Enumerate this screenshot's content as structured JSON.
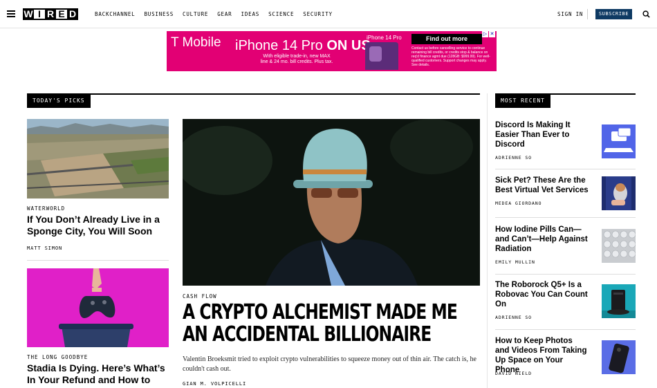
{
  "header": {
    "logo_letters": [
      "W",
      "I",
      "R",
      "E",
      "D"
    ],
    "nav": [
      "BACKCHANNEL",
      "BUSINESS",
      "CULTURE",
      "GEAR",
      "IDEAS",
      "SCIENCE",
      "SECURITY"
    ],
    "sign_in": "SIGN IN",
    "subscribe": "SUBSCRIBE"
  },
  "ad": {
    "brand": "T Mobile",
    "headline_a": "iPhone 14 Pro",
    "headline_b": "ON US",
    "sub": "With eligible trade-in, new MAX line & 24 mo. bill credits. Plus tax.",
    "product_label": "iPhone 14 Pro",
    "cta": "Find out more",
    "fine_print": "Contact us before cancelling service to continue remaining bill credits, or credits stop & balance on req'd finance agmt due (128GB: $999.99). For well-qualified customers. Support changes may apply. See details.",
    "color": "#e20074"
  },
  "picks": {
    "label": "TODAY'S PICKS",
    "left": [
      {
        "kicker": "WATERWORLD",
        "title": "If You Don’t Already Live in a Sponge City, You Will Soon",
        "author": "MATT SIMON"
      },
      {
        "kicker": "THE LONG GOODBYE",
        "title": "Stadia Is Dying. Here’s What’s In Your Refund and How to Get It",
        "author": ""
      }
    ],
    "hero": {
      "kicker": "CASH FLOW",
      "title": "A CRYPTO ALCHEMIST MADE ME AN ACCIDENTAL BILLIONAIRE",
      "dek": "Valentin Broeksmit tried to exploit crypto vulnerabilities to squeeze money out of thin air. The catch is, he couldn't cash out.",
      "author": "GIAN M. VOLPICELLI"
    }
  },
  "most_recent": {
    "label": "MOST RECENT",
    "items": [
      {
        "title": "Discord Is Making It Easier Than Ever to Discord",
        "author": "ADRIENNE SO"
      },
      {
        "title": "Sick Pet? These Are the Best Virtual Vet Services",
        "author": "MEDEA GIORDANO"
      },
      {
        "title": "How Iodine Pills Can—and Can’t—Help Against Radiation",
        "author": "EMILY MULLIN"
      },
      {
        "title": "The Roborock Q5+ Is a Robovac You Can Count On",
        "author": "ADRIENNE SO"
      },
      {
        "title": "How to Keep Photos and Videos From Taking Up Space on Your Phone",
        "author": "DAVID NIELD"
      }
    ]
  },
  "colors": {
    "accent": "#0e3a63",
    "magenta": "#e020c8",
    "ad": "#e20074"
  }
}
